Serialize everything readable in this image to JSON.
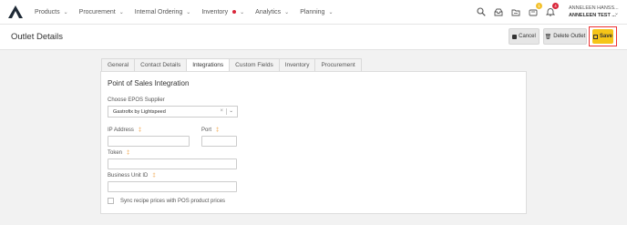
{
  "nav": {
    "menu": [
      {
        "label": "Products"
      },
      {
        "label": "Procurement"
      },
      {
        "label": "Internal Ordering"
      },
      {
        "label": "Inventory"
      },
      {
        "label": "Analytics"
      },
      {
        "label": "Planning"
      }
    ],
    "badges": {
      "orders": "1",
      "notifications": "4"
    },
    "user_name": "ANNELEEN HANSS...",
    "user_org": "ANNELEEN TEST ..."
  },
  "header": {
    "title": "Outlet Details",
    "cancel_label": "Cancel",
    "delete_label": "Delete Outlet",
    "save_label": "Save"
  },
  "tabs": [
    {
      "label": "General"
    },
    {
      "label": "Contact Details"
    },
    {
      "label": "Integrations"
    },
    {
      "label": "Custom Fields"
    },
    {
      "label": "Inventory"
    },
    {
      "label": "Procurement"
    }
  ],
  "form": {
    "section_title": "Point of Sales Integration",
    "supplier_label": "Choose EPOS Supplier",
    "supplier_value": "Gastrofix by Lightspeed",
    "ip_label": "IP Address",
    "port_label": "Port",
    "token_label": "Token",
    "bu_label": "Business Unit ID",
    "sync_label": "Sync recipe prices with POS product prices",
    "required_mark": "‡",
    "ip_value": "",
    "port_value": "",
    "token_value": "",
    "bu_value": ""
  },
  "colors": {
    "accent": "#f5c518",
    "highlight": "#ee3333",
    "badge_red": "#d9263a",
    "badge_yellow": "#f3c12c"
  }
}
